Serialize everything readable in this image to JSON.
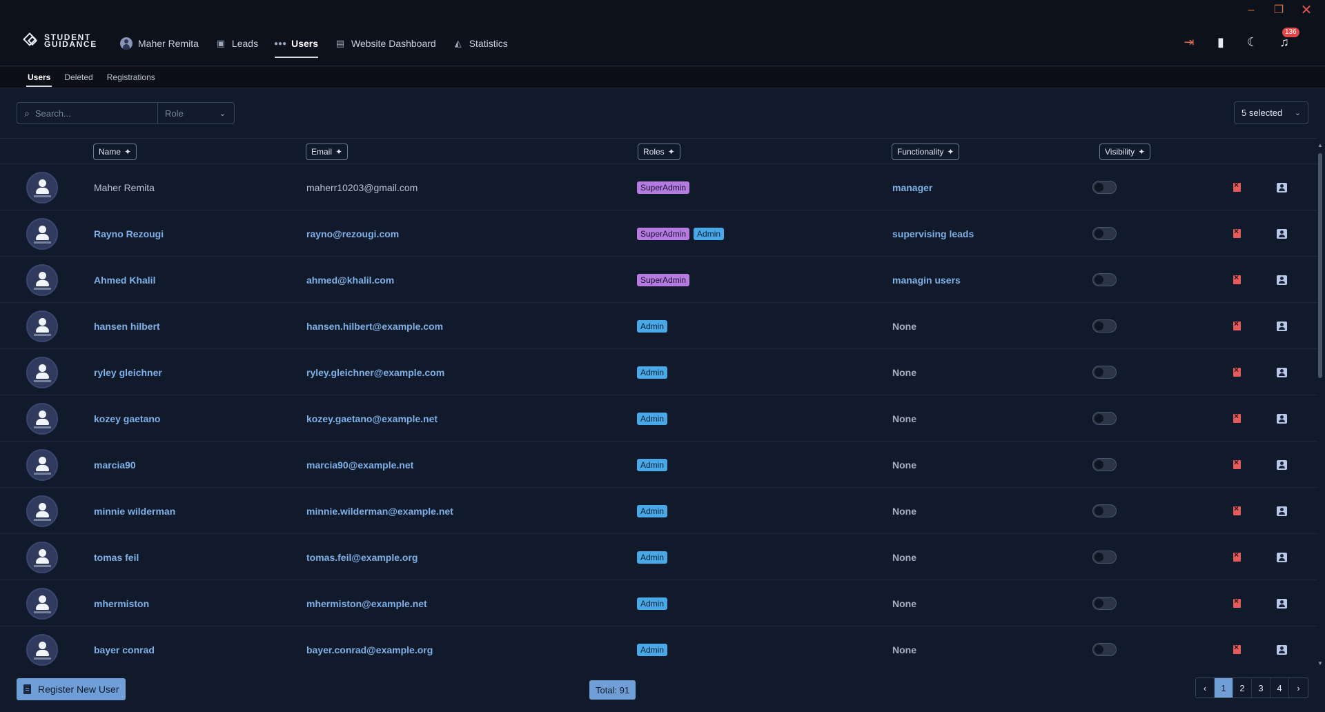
{
  "brand": {
    "line1": "STUDENT",
    "line2": "GUIDANCE"
  },
  "window": {
    "minimize": "–",
    "restore": "❐",
    "close": "✕"
  },
  "nav": {
    "user": "Maher Remita",
    "items": [
      {
        "label": "Leads",
        "icon": "leads-icon"
      },
      {
        "label": "Users",
        "icon": "users-icon",
        "active": true
      },
      {
        "label": "Website Dashboard",
        "icon": "dashboard-icon"
      },
      {
        "label": "Statistics",
        "icon": "statistics-icon"
      }
    ]
  },
  "top_actions": {
    "notifications_count": "136"
  },
  "subtabs": [
    "Users",
    "Deleted",
    "Registrations"
  ],
  "filters": {
    "search_placeholder": "Search...",
    "role_placeholder": "Role",
    "columns_selected": "5 selected"
  },
  "columns": [
    "Name",
    "Email",
    "Roles",
    "Functionality",
    "Visibility"
  ],
  "rows": [
    {
      "name": "Maher Remita",
      "email": "maherr10203@gmail.com",
      "roles": [
        "SuperAdmin"
      ],
      "functionality": "manager",
      "visible": false
    },
    {
      "name": "Rayno Rezougi",
      "email": "rayno@rezougi.com",
      "roles": [
        "SuperAdmin",
        "Admin"
      ],
      "functionality": "supervising leads",
      "visible": false
    },
    {
      "name": "Ahmed Khalil",
      "email": "ahmed@khalil.com",
      "roles": [
        "SuperAdmin"
      ],
      "functionality": "managin users",
      "visible": false
    },
    {
      "name": "hansen hilbert",
      "email": "hansen.hilbert@example.com",
      "roles": [
        "Admin"
      ],
      "functionality": "None",
      "visible": false
    },
    {
      "name": "ryley gleichner",
      "email": "ryley.gleichner@example.com",
      "roles": [
        "Admin"
      ],
      "functionality": "None",
      "visible": false
    },
    {
      "name": "kozey gaetano",
      "email": "kozey.gaetano@example.net",
      "roles": [
        "Admin"
      ],
      "functionality": "None",
      "visible": false
    },
    {
      "name": "marcia90",
      "email": "marcia90@example.net",
      "roles": [
        "Admin"
      ],
      "functionality": "None",
      "visible": false
    },
    {
      "name": "minnie wilderman",
      "email": "minnie.wilderman@example.net",
      "roles": [
        "Admin"
      ],
      "functionality": "None",
      "visible": false
    },
    {
      "name": "tomas feil",
      "email": "tomas.feil@example.org",
      "roles": [
        "Admin"
      ],
      "functionality": "None",
      "visible": false
    },
    {
      "name": "mhermiston",
      "email": "mhermiston@example.net",
      "roles": [
        "Admin"
      ],
      "functionality": "None",
      "visible": false
    },
    {
      "name": "bayer conrad",
      "email": "bayer.conrad@example.org",
      "roles": [
        "Admin"
      ],
      "functionality": "None",
      "visible": false
    }
  ],
  "footer": {
    "register_label": "Register New User",
    "total_label": "Total: 91",
    "pages": [
      "1",
      "2",
      "3",
      "4"
    ],
    "current_page": "1",
    "prev": "‹",
    "next": "›"
  },
  "colors": {
    "accent": "#6f9fd6",
    "superadmin": "#b57be0",
    "admin": "#49a9e8",
    "danger": "#e55b5b"
  }
}
